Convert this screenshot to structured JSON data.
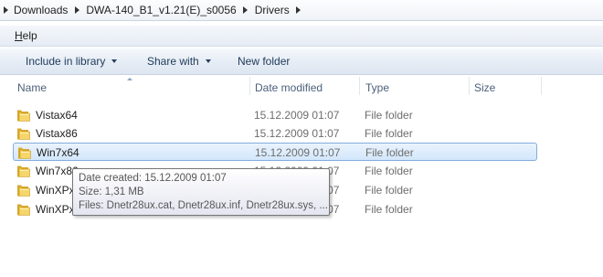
{
  "address_bar": {
    "crumbs": [
      "Downloads",
      "DWA-140_B1_v1.21(E)_s0056",
      "Drivers"
    ]
  },
  "menu": {
    "items": [
      {
        "underline": "H",
        "rest": "elp"
      }
    ]
  },
  "toolbar": {
    "include_in_library": "Include in library",
    "share_with": "Share with",
    "new_folder": "New folder"
  },
  "columns": {
    "name": "Name",
    "date_modified": "Date modified",
    "type": "Type",
    "size": "Size"
  },
  "rows": [
    {
      "name": "Vistax64",
      "date": "15.12.2009 01:07",
      "type": "File folder",
      "selected": false
    },
    {
      "name": "Vistax86",
      "date": "15.12.2009 01:07",
      "type": "File folder",
      "selected": false
    },
    {
      "name": "Win7x64",
      "date": "15.12.2009 01:07",
      "type": "File folder",
      "selected": true
    },
    {
      "name": "Win7x86",
      "date": "15.12.2009 01:07",
      "type": "File folder",
      "selected": false
    },
    {
      "name": "WinXPx",
      "date": "15.12.2009 01:07",
      "type": "File folder",
      "selected": false
    },
    {
      "name": "WinXPx",
      "date": "15.12.2009 01:07",
      "type": "File folder",
      "selected": false
    }
  ],
  "tooltip": {
    "line1": "Date created: 15.12.2009 01:07",
    "line2": "Size: 1,31 MB",
    "line3": "Files: Dnetr28ux.cat, Dnetr28ux.inf, Dnetr28ux.sys, ..."
  },
  "colors": {
    "selection_border": "#84acdd",
    "folder_yellow": "#f3cf5a",
    "command_text": "#1e395b"
  },
  "icons": {
    "breadcrumb_separator": "chevron-right-icon",
    "folder": "folder-icon",
    "dropdown": "dropdown-arrow-icon"
  }
}
